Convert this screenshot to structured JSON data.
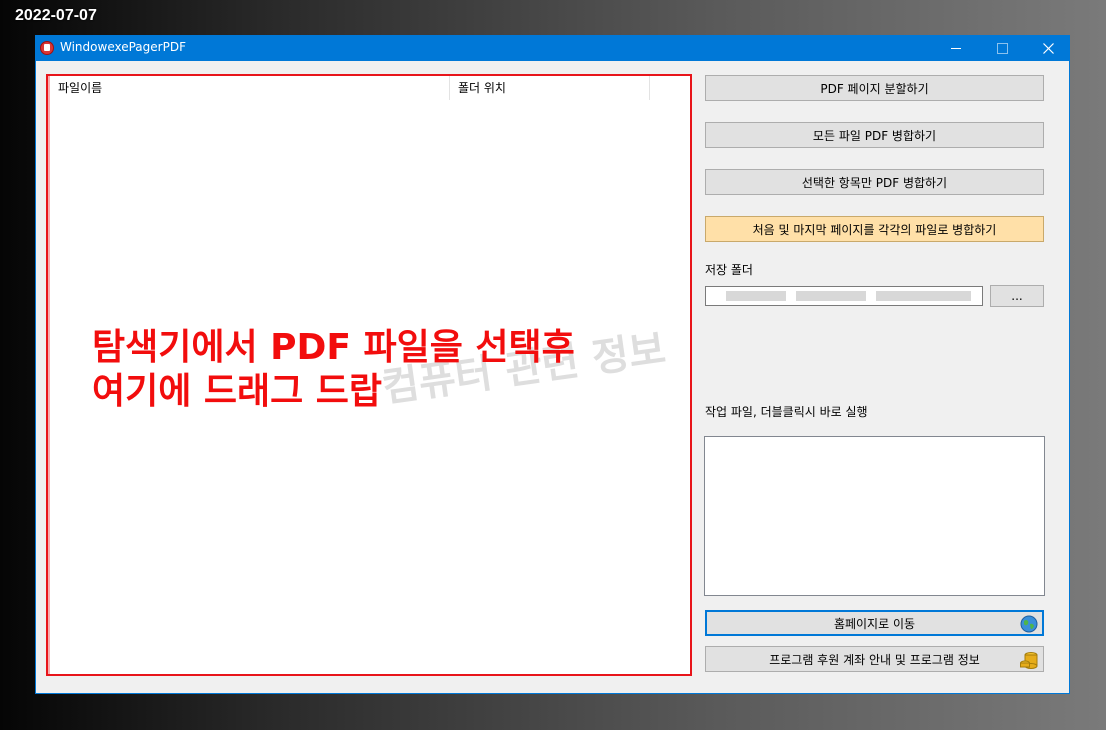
{
  "date_stamp": "2022-07-07",
  "window": {
    "title": "WindowexePagerPDF",
    "minimize_glyph": "",
    "maximize_glyph": "",
    "close_glyph": ""
  },
  "file_list": {
    "columns": [
      "파일이름",
      "폴더 위치"
    ],
    "drop_hint_lines": [
      "탐색기에서 PDF 파일을 선택후",
      "여기에 드래그 드랍"
    ],
    "watermark": "컴퓨터 관련 정보"
  },
  "buttons": {
    "split": "PDF 페이지  분할하기",
    "merge_all": "모든  파일 PDF 병합하기",
    "merge_selected": "선택한  항목만 PDF  병합하기",
    "merge_first_last": "처음  및  마지막 페이지를 각각의 파일로  병합하기",
    "homepage": "홈페이지로  이동",
    "donate": "프로그램  후원  계좌  안내  및  프로그램  정보",
    "browse": "..."
  },
  "save_folder": {
    "label": "저장  폴더",
    "value": ""
  },
  "work_files": {
    "label": "작업 파일, 더블클릭시 바로 실행"
  },
  "icons": {
    "app": "pdf-app-icon",
    "homepage": "globe-icon",
    "donate": "coins-icon"
  },
  "colors": {
    "titlebar": "#0078d7",
    "drop_border": "#e8141a",
    "drop_text": "#f20d0d",
    "highlight_button": "#ffe0a8"
  }
}
